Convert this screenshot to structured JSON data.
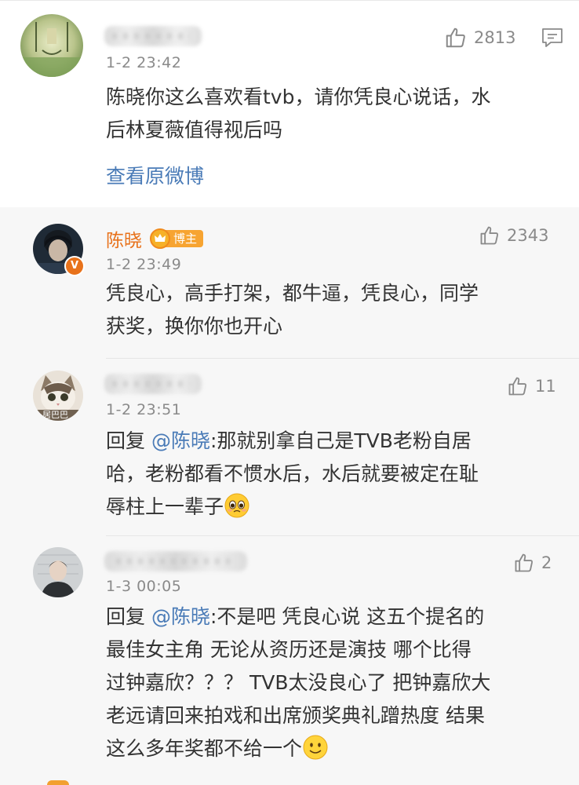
{
  "top_comment": {
    "username": "",
    "time": "1-2 23:42",
    "likes": "2813",
    "text_line1": "陈晓你这么喜欢看tvb，请你凭良心说话，水",
    "text_line2": "后林夏薇值得视后吗",
    "view_original": "查看原微博"
  },
  "replies": [
    {
      "username": "陈晓",
      "badge": "博主",
      "time": "1-2 23:49",
      "likes": "2343",
      "lines": [
        "凭良心，高手打架，都牛逼，凭良心，同学",
        "获奖，换你你也开心"
      ]
    },
    {
      "username": "",
      "avatar_caption": "居巴巴",
      "time": "1-2 23:51",
      "likes": "11",
      "reply_prefix": "回复",
      "mention": "@陈晓",
      "line1": ":那就别拿自己是TVB老粉自居",
      "line2": "哈，老粉都看不惯水后，水后就要被定在耻",
      "line3": "辱柱上一辈子"
    },
    {
      "username": "",
      "time": "1-3 00:05",
      "likes": "2",
      "reply_prefix": "回复",
      "mention": "@陈晓",
      "line1": ":不是吧 凭良心说 这五个提名的",
      "line2": "最佳女主角 无论从资历还是演技 哪个比得",
      "line3": "过钟嘉欣？？？ TVB太没良心了 把钟嘉欣大",
      "line4": "老远请回来拍戏和出席颁奖典礼蹭热度 结果",
      "line5": "这么多年奖都不给一个"
    }
  ],
  "colors": {
    "link": "#4a7bb7",
    "author": "#e8721b",
    "badge": "#f7a431",
    "muted": "#8a8a8a",
    "reply_bg": "#f7f7f7"
  },
  "icons": [
    "thumbs-up-icon",
    "reply-icon",
    "crown-icon",
    "verified-icon",
    "emoji-pleading",
    "emoji-smile"
  ]
}
